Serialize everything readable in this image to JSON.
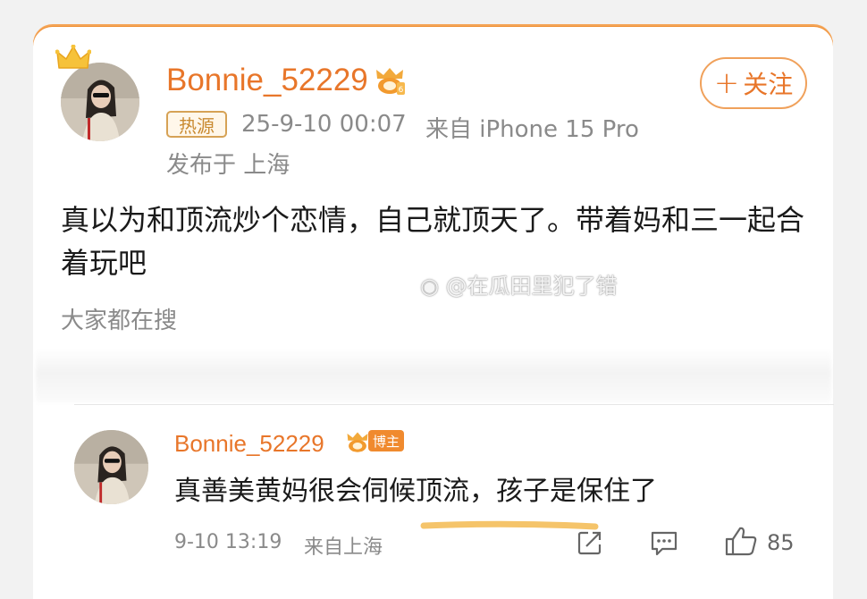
{
  "post": {
    "username": "Bonnie_52229",
    "hot_tag": "热源",
    "datetime": "25-9-10 00:07",
    "source": "来自 iPhone 15 Pro",
    "location": "发布于 上海",
    "follow_label": "关注",
    "follow_plus": "+",
    "content": "真以为和顶流炒个恋情，自己就顶天了。带着妈和三一起合着玩吧",
    "search_hint": "大家都在搜"
  },
  "watermark": "@在瓜田里犯了错",
  "reply": {
    "username": "Bonnie_52229",
    "role_tag": "博主",
    "content": "真善美黄妈很会伺候顶流，孩子是保住了",
    "datetime": "9-10 13:19",
    "source": "来自上海",
    "like_count": "85"
  },
  "colors": {
    "accent": "#e8762a",
    "underline": "#f5c46a",
    "muted_text": "#8a8a8a"
  },
  "icons": [
    "crown-icon",
    "vip-badge-icon",
    "weibo-icon",
    "share-icon",
    "comment-icon",
    "like-icon"
  ]
}
